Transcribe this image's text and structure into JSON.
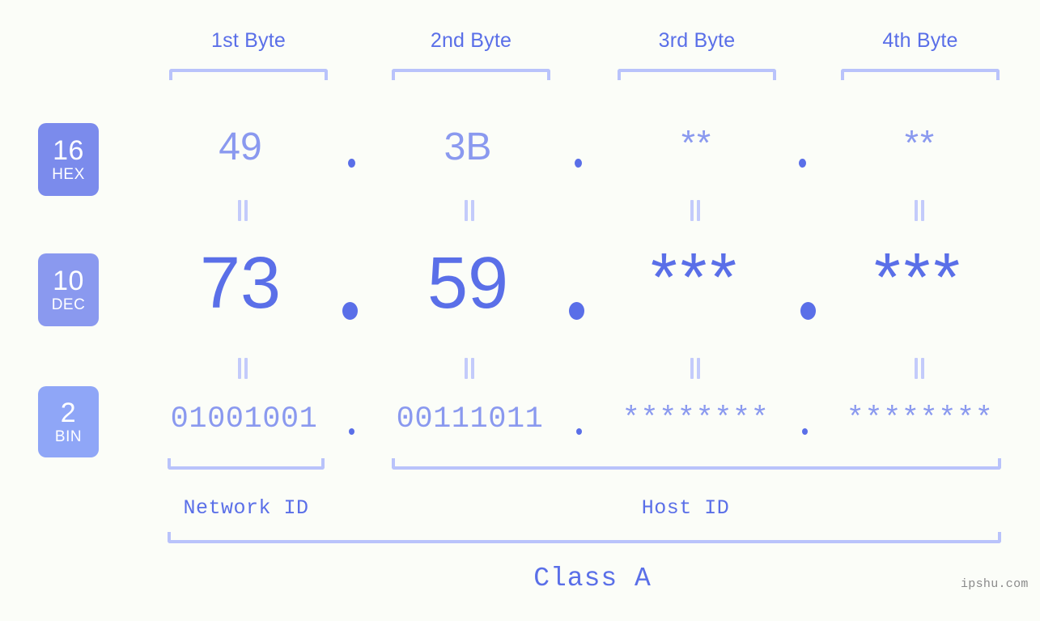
{
  "meta": {
    "watermark": "ipshu.com",
    "background_color": "#fbfdf8",
    "accent_strong": "#5a6fe8",
    "accent_light": "#8a99ef",
    "accent_bracket": "#b9c3fb"
  },
  "byte_headers": [
    {
      "label": "1st Byte"
    },
    {
      "label": "2nd Byte"
    },
    {
      "label": "3rd Byte"
    },
    {
      "label": "4th Byte"
    }
  ],
  "rows": [
    {
      "badge": {
        "base": "16",
        "name": "HEX",
        "color": "#7b8bec"
      },
      "values": [
        "49",
        "3B",
        "**",
        "**"
      ],
      "separator": "."
    },
    {
      "badge": {
        "base": "10",
        "name": "DEC",
        "color": "#8a99ef"
      },
      "values": [
        "73",
        "59",
        "***",
        "***"
      ],
      "separator": "."
    },
    {
      "badge": {
        "base": "2",
        "name": "BIN",
        "color": "#8fa6f7"
      },
      "values": [
        "01001001",
        "00111011",
        "********",
        "********"
      ],
      "separator": "."
    }
  ],
  "equals_marks": {
    "symbol": "||",
    "count_per_row": 4,
    "rows": 2
  },
  "segments": {
    "network_id": {
      "label": "Network ID"
    },
    "host_id": {
      "label": "Host ID"
    },
    "class": {
      "label": "Class A"
    }
  }
}
